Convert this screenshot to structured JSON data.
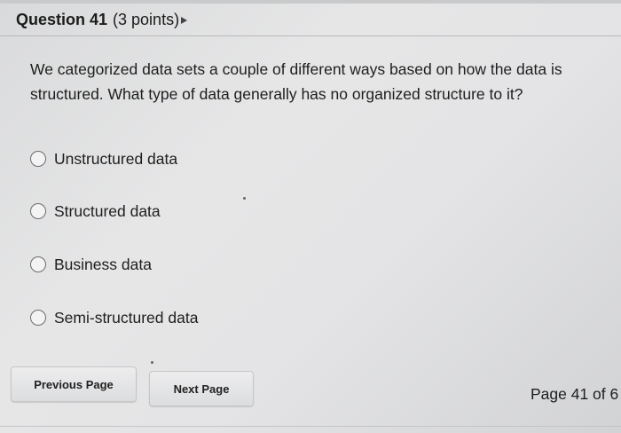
{
  "question": {
    "number_label": "Question 41",
    "points_label": "(3 points)",
    "text": "We categorized data sets a couple of different ways based on how the data is structured.  What type of data generally has no organized structure to it?"
  },
  "options": [
    {
      "label": "Unstructured data",
      "selected": false
    },
    {
      "label": "Structured data",
      "selected": false
    },
    {
      "label": "Business data",
      "selected": false
    },
    {
      "label": "Semi-structured data",
      "selected": false
    }
  ],
  "navigation": {
    "previous_label": "Previous Page",
    "next_label": "Next Page",
    "page_indicator": "Page 41 of 6"
  }
}
